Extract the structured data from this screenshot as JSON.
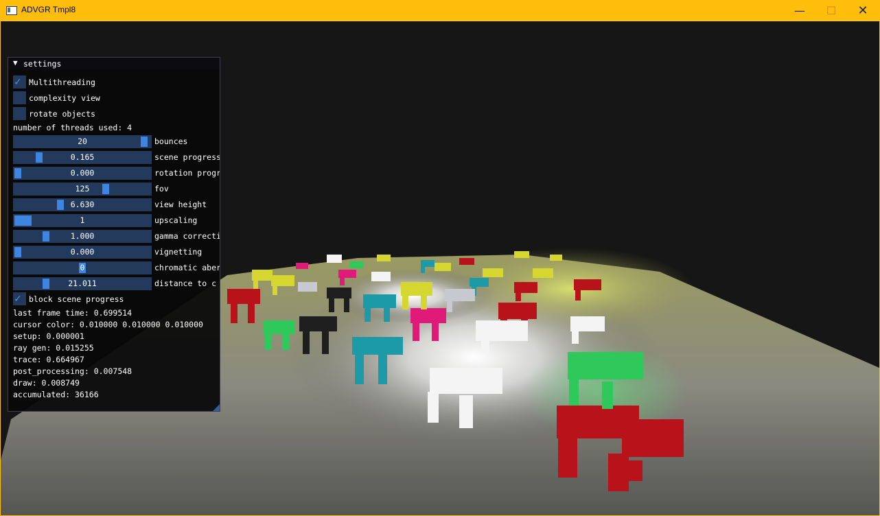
{
  "window": {
    "title": "ADVGR Tmpl8"
  },
  "panel": {
    "title": "settings",
    "checkboxes": [
      {
        "label": "Multithreading",
        "checked": true
      },
      {
        "label": "complexity view",
        "checked": false
      },
      {
        "label": "rotate objects",
        "checked": false
      }
    ],
    "threads_text": "number of threads used: 4",
    "sliders": [
      {
        "value": "20",
        "label": "bounces",
        "fraction": 0.98
      },
      {
        "value": "0.165",
        "label": "scene progress",
        "fraction": 0.165
      },
      {
        "value": "0.000",
        "label": "rotation progress",
        "fraction": 0.0
      },
      {
        "value": "125",
        "label": "fov",
        "fraction": 0.68
      },
      {
        "value": "6.630",
        "label": "view height",
        "fraction": 0.33
      },
      {
        "value": "1",
        "label": "upscaling",
        "fraction": 0.0
      },
      {
        "value": "1.000",
        "label": "gamma correction",
        "fraction": 0.22
      },
      {
        "value": "0.000",
        "label": "vignetting",
        "fraction": 0.0
      },
      {
        "value": "0",
        "label": "chromatic aberration",
        "fraction": 0.5
      },
      {
        "value": "21.011",
        "label": "distance to c",
        "fraction": 0.22
      }
    ],
    "block_checkbox": {
      "label": "block scene progress",
      "checked": true
    },
    "stats": [
      "last frame time: 0.699514",
      "cursor color: 0.010000 0.010000 0.010000",
      "setup: 0.000001",
      "ray gen: 0.015255",
      "trace: 0.664967",
      "post_processing: 0.007548",
      "draw: 0.008749",
      "accumulated: 36166"
    ]
  }
}
